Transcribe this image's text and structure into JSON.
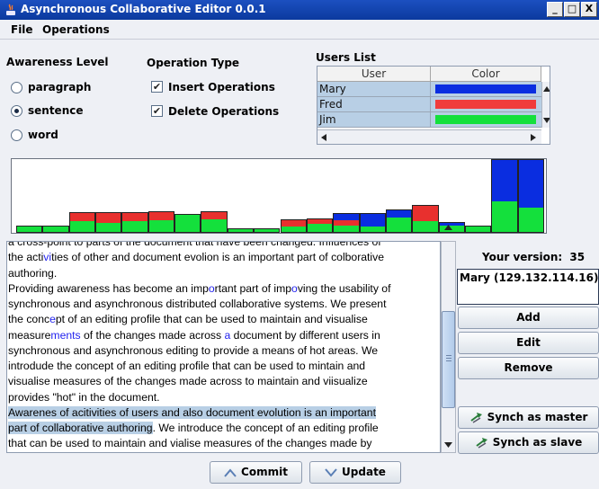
{
  "window": {
    "title": "Asynchronous Collaborative Editor 0.0.1",
    "minimize": "_",
    "maximize": "□",
    "close": "X"
  },
  "menu": {
    "file": "File",
    "operations": "Operations"
  },
  "awareness": {
    "heading": "Awareness Level",
    "options": [
      "paragraph",
      "sentence",
      "word"
    ],
    "selected": "sentence"
  },
  "operation_type": {
    "heading": "Operation Type",
    "insert": "Insert Operations",
    "delete": "Delete Operations",
    "insert_checked": true,
    "delete_checked": true
  },
  "users": {
    "heading": "Users List",
    "columns": [
      "User",
      "Color"
    ],
    "rows": [
      {
        "name": "Mary",
        "color": "#0a2de0"
      },
      {
        "name": "Fred",
        "color": "#f03c3c"
      },
      {
        "name": "Jim",
        "color": "#14e03c"
      }
    ]
  },
  "histogram": {
    "colors": {
      "blue": "#0a2de0",
      "red": "#e8302e",
      "green": "#14e03c"
    },
    "bars": [
      {
        "green": 8,
        "red": 0,
        "blue": 0
      },
      {
        "green": 8,
        "red": 0,
        "blue": 0
      },
      {
        "green": 13,
        "red": 9,
        "blue": 0
      },
      {
        "green": 10,
        "red": 12,
        "blue": 0
      },
      {
        "green": 13,
        "red": 9,
        "blue": 0
      },
      {
        "green": 14,
        "red": 9,
        "blue": 0
      },
      {
        "green": 20,
        "red": 0,
        "blue": 0
      },
      {
        "green": 15,
        "red": 8,
        "blue": 0
      },
      {
        "green": 5,
        "red": 0,
        "blue": 0
      },
      {
        "green": 5,
        "red": 0,
        "blue": 0
      },
      {
        "green": 7,
        "red": 7,
        "blue": 0
      },
      {
        "green": 10,
        "red": 5,
        "blue": 0
      },
      {
        "green": 7,
        "red": 7,
        "blue": 7
      },
      {
        "green": 6,
        "red": 0,
        "blue": 15
      },
      {
        "green": 17,
        "red": 0,
        "blue": 8
      },
      {
        "green": 12,
        "red": 18,
        "blue": 0
      },
      {
        "green": 8,
        "red": 0,
        "blue": 3
      },
      {
        "green": 8,
        "red": 0,
        "blue": 0
      },
      {
        "green": 33,
        "red": 0,
        "blue": 45
      },
      {
        "green": 26,
        "red": 0,
        "blue": 52
      }
    ]
  },
  "document": {
    "lines": [
      [
        {
          "t": "a cross-point to parts of the document that have been changed. Influences of",
          "s": ""
        }
      ],
      [
        {
          "t": "the acti",
          "s": ""
        },
        {
          "t": "vi",
          "s": "b"
        },
        {
          "t": "ties of other  and document  evolion is an important part of colborative",
          "s": ""
        }
      ],
      [
        {
          "t": "authoring.",
          "s": ""
        }
      ],
      [
        {
          "t": "Providing awareness has become an imp",
          "s": ""
        },
        {
          "t": "o",
          "s": "b"
        },
        {
          "t": "rtant  part of imp",
          "s": ""
        },
        {
          "t": "o",
          "s": "b"
        },
        {
          "t": "ving the usability of",
          "s": ""
        }
      ],
      [
        {
          "t": "synchronous and asynchronous distributed collaborative systems. We  present",
          "s": ""
        }
      ],
      [
        {
          "t": "the conc",
          "s": ""
        },
        {
          "t": "e",
          "s": "b"
        },
        {
          "t": "pt of an  editing profile that  can be used to maintain and visualise",
          "s": ""
        }
      ],
      [
        {
          "t": "measure",
          "s": ""
        },
        {
          "t": "ments",
          "s": "b"
        },
        {
          "t": " of the changes made across ",
          "s": ""
        },
        {
          "t": "a",
          "s": "b"
        },
        {
          "t": " document by different users in",
          "s": ""
        }
      ],
      [
        {
          "t": "synchronous and  asynchronous editing to provide a means of hot areas.  We",
          "s": ""
        }
      ],
      [
        {
          "t": "introdude the concept of an  editing profile that can be used  to mintain and",
          "s": ""
        }
      ],
      [
        {
          "t": "visualise measures of the changes made across  to maintain and viisualize",
          "s": ""
        }
      ],
      [
        {
          "t": "provides  \"hot\"  in the document.",
          "s": ""
        }
      ],
      [
        {
          "t": "Awarenes of  acitivities of  users and also document  evolution is an important",
          "s": "hl"
        }
      ],
      [
        {
          "t": "part of collaborative authoring",
          "s": "hl"
        },
        {
          "t": ". We introduce the concept of an editing profile",
          "s": ""
        }
      ],
      [
        {
          "t": "that can be used to maintain and vialise measures of the changes made by",
          "s": ""
        }
      ]
    ]
  },
  "version": {
    "label": "Your version:",
    "number": "35",
    "entries": [
      "Mary (129.132.114.16)"
    ]
  },
  "buttons": {
    "add": "Add",
    "edit": "Edit",
    "remove": "Remove",
    "synch_master": "Synch as master",
    "synch_slave": "Synch as slave",
    "commit": "Commit",
    "update": "Update"
  }
}
